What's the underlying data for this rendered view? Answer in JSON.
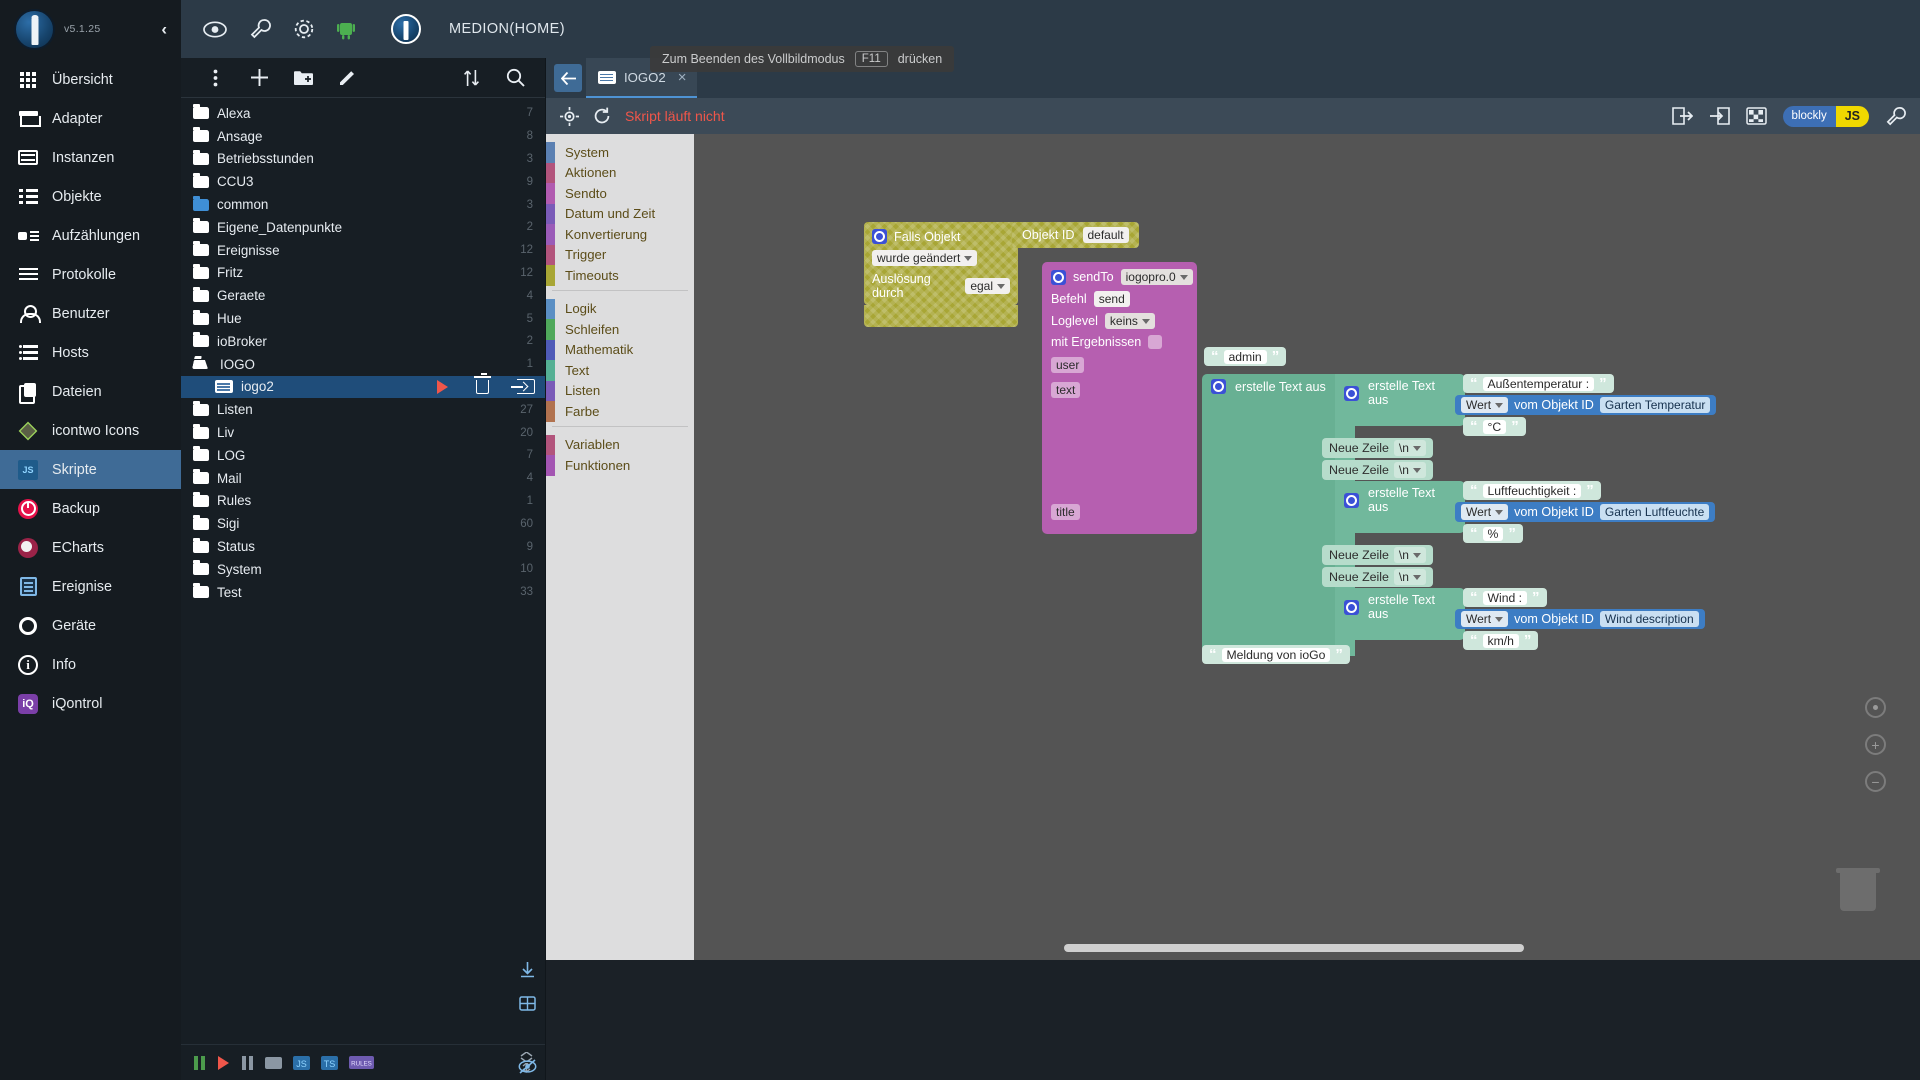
{
  "app": {
    "version": "v5.1.25",
    "host_title": "MEDION(HOME)"
  },
  "sidebar": {
    "collapse_icon": "‹",
    "items": [
      {
        "label": "Übersicht",
        "icon": "grid-icon",
        "active": false
      },
      {
        "label": "Adapter",
        "icon": "shop-icon",
        "active": false
      },
      {
        "label": "Instanzen",
        "icon": "instances-icon",
        "active": false
      },
      {
        "label": "Objekte",
        "icon": "list-icon",
        "active": false
      },
      {
        "label": "Aufzählungen",
        "icon": "enum-icon",
        "active": false
      },
      {
        "label": "Protokolle",
        "icon": "lines-icon",
        "active": false
      },
      {
        "label": "Benutzer",
        "icon": "user-icon",
        "active": false
      },
      {
        "label": "Hosts",
        "icon": "hosts-icon",
        "active": false
      },
      {
        "label": "Dateien",
        "icon": "files-icon",
        "active": false
      },
      {
        "label": "icontwo Icons",
        "icon": "diamond-icon",
        "active": false
      },
      {
        "label": "Skripte",
        "icon": "js-icon",
        "active": true
      },
      {
        "label": "Backup",
        "icon": "backup-icon",
        "active": false
      },
      {
        "label": "ECharts",
        "icon": "echarts-icon",
        "active": false
      },
      {
        "label": "Ereignise",
        "icon": "note-icon",
        "active": false
      },
      {
        "label": "Geräte",
        "icon": "devices-icon",
        "active": false
      },
      {
        "label": "Info",
        "icon": "info-icon",
        "active": false
      },
      {
        "label": "iQontrol",
        "icon": "iqontrol-icon",
        "active": false
      }
    ]
  },
  "topbar": {
    "icons": [
      "eye-icon",
      "wrench-icon",
      "gear-icon",
      "android-icon"
    ],
    "title": "MEDION(HOME)"
  },
  "tree": {
    "toolbar": {
      "more_icon": "more-vertical-icon",
      "add_icon": "plus-icon",
      "add_folder_icon": "new-folder-icon",
      "edit_icon": "pencil-icon",
      "sort_icon": "sort-icon",
      "search_icon": "search-icon"
    },
    "items": [
      {
        "name": "Alexa",
        "type": "folder",
        "count": "7",
        "selected": false
      },
      {
        "name": "Ansage",
        "type": "folder",
        "count": "8",
        "selected": false
      },
      {
        "name": "Betriebsstunden",
        "type": "folder",
        "count": "3",
        "selected": false
      },
      {
        "name": "CCU3",
        "type": "folder",
        "count": "9",
        "selected": false
      },
      {
        "name": "common",
        "type": "folder-blue",
        "count": "3",
        "selected": false
      },
      {
        "name": "Eigene_Datenpunkte",
        "type": "folder",
        "count": "2",
        "selected": false
      },
      {
        "name": "Ereignisse",
        "type": "folder",
        "count": "12",
        "selected": false
      },
      {
        "name": "Fritz",
        "type": "folder",
        "count": "12",
        "selected": false
      },
      {
        "name": "Geraete",
        "type": "folder",
        "count": "4",
        "selected": false
      },
      {
        "name": "Hue",
        "type": "folder",
        "count": "5",
        "selected": false
      },
      {
        "name": "ioBroker",
        "type": "folder",
        "count": "2",
        "selected": false
      },
      {
        "name": "IOGO",
        "type": "folder-open",
        "count": "1",
        "selected": false
      },
      {
        "name": "iogo2",
        "type": "script",
        "count": "",
        "selected": true,
        "indent": true
      },
      {
        "name": "Listen",
        "type": "folder",
        "count": "27",
        "selected": false
      },
      {
        "name": "Liv",
        "type": "folder",
        "count": "20",
        "selected": false
      },
      {
        "name": "LOG",
        "type": "folder",
        "count": "7",
        "selected": false
      },
      {
        "name": "Mail",
        "type": "folder",
        "count": "4",
        "selected": false
      },
      {
        "name": "Rules",
        "type": "folder",
        "count": "1",
        "selected": false
      },
      {
        "name": "Sigi",
        "type": "folder",
        "count": "60",
        "selected": false
      },
      {
        "name": "Status",
        "type": "folder",
        "count": "9",
        "selected": false
      },
      {
        "name": "System",
        "type": "folder",
        "count": "10",
        "selected": false
      },
      {
        "name": "Test",
        "type": "folder",
        "count": "33",
        "selected": false
      }
    ],
    "row_actions": {
      "run_icon": "play-icon",
      "delete_icon": "trash-icon",
      "export_icon": "export-icon"
    },
    "footer": {
      "pause_icon": "pause-icon",
      "play_icon": "play-icon",
      "pause2_icon": "pause-icon",
      "bar_icon": "bar-icon",
      "js_badge": "JS",
      "ts_badge": "TS",
      "rules_badge": "RULES",
      "expand_icon": "expand-icon",
      "collapse_icon": "collapse-icon"
    }
  },
  "editor": {
    "back_icon": "arrow-left-icon",
    "tab": {
      "label": "IOGO2",
      "icon": "script-icon",
      "close_icon": "close-icon"
    },
    "fullscreen_hint": {
      "before": "Zum Beenden des Vollbildmodus",
      "key": "F11",
      "after": "drücken"
    },
    "runbar": {
      "target_icon": "crosshair-icon",
      "reload_icon": "reload-icon",
      "status": "Skript läuft nicht",
      "export_icon": "export-blocks-icon",
      "import_icon": "import-blocks-icon",
      "checker_icon": "checkerboard-icon",
      "blockly_label": "blockly",
      "js_label": "JS",
      "settings_icon": "wrench-icon"
    },
    "rail": {
      "download_icon": "download-icon",
      "log_icon": "log-icon",
      "hide_icon": "eye-off-icon"
    },
    "zoom_controls": {
      "center_icon": "center-icon",
      "zoom_in": "+",
      "zoom_out": "−",
      "trash_icon": "trash-icon"
    }
  },
  "toolbox": {
    "groups": [
      {
        "items": [
          {
            "label": "System",
            "color": "#5b80b2"
          },
          {
            "label": "Aktionen",
            "color": "#b2547c"
          },
          {
            "label": "Sendto",
            "color": "#b15bb0"
          },
          {
            "label": "Datum und Zeit",
            "color": "#7a5bb8"
          },
          {
            "label": "Konvertierung",
            "color": "#9a5bb8"
          },
          {
            "label": "Trigger",
            "color": "#b2547c"
          },
          {
            "label": "Timeouts",
            "color": "#a8a635"
          }
        ]
      },
      {
        "items": [
          {
            "label": "Logik",
            "color": "#5b8fc4"
          },
          {
            "label": "Schleifen",
            "color": "#4fa85b"
          },
          {
            "label": "Mathematik",
            "color": "#4f5bb8"
          },
          {
            "label": "Text",
            "color": "#55b094"
          },
          {
            "label": "Listen",
            "color": "#7a5bb8"
          },
          {
            "label": "Farbe",
            "color": "#b1724f"
          }
        ]
      },
      {
        "items": [
          {
            "label": "Variablen",
            "color": "#b2547c"
          },
          {
            "label": "Funktionen",
            "color": "#a355b2"
          }
        ]
      }
    ]
  },
  "workspace": {
    "trigger": {
      "title": "Falls Objekt",
      "mode": "wurde geändert",
      "trigger_by_label": "Auslösung durch",
      "trigger_by_value": "egal"
    },
    "object_id": {
      "label": "Objekt ID",
      "value": "default"
    },
    "sendto": {
      "title": "sendTo",
      "instance": "iogopro.0",
      "cmd_label": "Befehl",
      "cmd_value": "send",
      "loglevel_label": "Loglevel",
      "loglevel_value": "keins",
      "results_label": "mit Ergebnissen",
      "user_label": "user",
      "text_label": "text",
      "title_label": "title"
    },
    "user_value": "admin",
    "title_value": "Meldung von ioGo",
    "create_text_label": "erstelle Text aus",
    "newline_label": "Neue Zeile",
    "newline_value": "\\n",
    "value_label": "Wert",
    "objid_prefix": "vom Objekt ID",
    "segments": [
      {
        "caption": "Außentemperatur :",
        "objid": "Garten Temperatur",
        "unit": "°C"
      },
      {
        "caption": "Luftfeuchtigkeit :",
        "objid": "Garten Luftfeuchte",
        "unit": "%"
      },
      {
        "caption": "Wind :",
        "objid": "Wind description",
        "unit": "km/h"
      }
    ]
  }
}
